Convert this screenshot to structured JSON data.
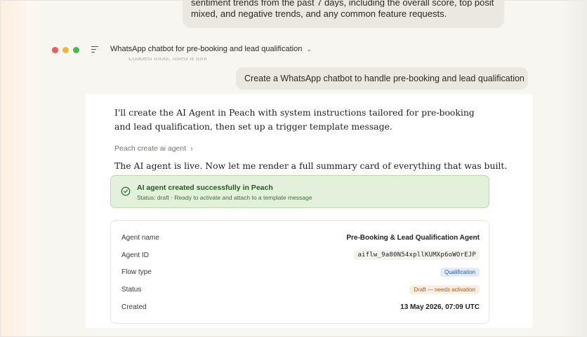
{
  "previous_message": {
    "line1_clipped": "sentiment trends from the past 7 days, including the overall score, top positive,",
    "line2": "mixed, and negative trends, and any common feature requests."
  },
  "chat": {
    "title": "WhatsApp chatbot for pre-booking and lead qualification",
    "ghost_text": "Loaded tools, used a tool"
  },
  "user_message": "Create a WhatsApp chatbot to handle pre-booking and lead qualification",
  "assistant": {
    "intro": "I'll create the AI Agent in Peach with system instructions tailored for pre-booking and lead qualification, then set up a trigger template message.",
    "tool_call": "Peach create ai agent",
    "followup": "The AI agent is live. Now let me render a full summary card of everything that was built."
  },
  "success": {
    "title": "AI agent created successfully in Peach",
    "subtitle": "Status: draft · Ready to activate and attach to a template message",
    "color": "#235a1e"
  },
  "summary": {
    "rows": [
      {
        "label": "Agent name",
        "value": "Pre-Booking & Lead Qualification Agent"
      },
      {
        "label": "Agent ID",
        "value": "aiflw_9a80N54xpllKUMXp6oWOrEJP"
      },
      {
        "label": "Flow type",
        "value": "Qualification"
      },
      {
        "label": "Status",
        "value": "Draft — needs activation"
      },
      {
        "label": "Created",
        "value": "13 May 2026, 07:09 UTC"
      }
    ]
  },
  "colors": {
    "window_dots": [
      "#ed5b52",
      "#f3b43a",
      "#3fbf4b"
    ],
    "badge_blue": "#2a5aa3",
    "badge_amber": "#a35a18"
  },
  "icons": [
    "window-close-dot",
    "window-minimize-dot",
    "window-maximize-dot",
    "sidebar-menu-icon",
    "chevron-down-icon",
    "chevron-right-icon",
    "check-circle-icon"
  ]
}
